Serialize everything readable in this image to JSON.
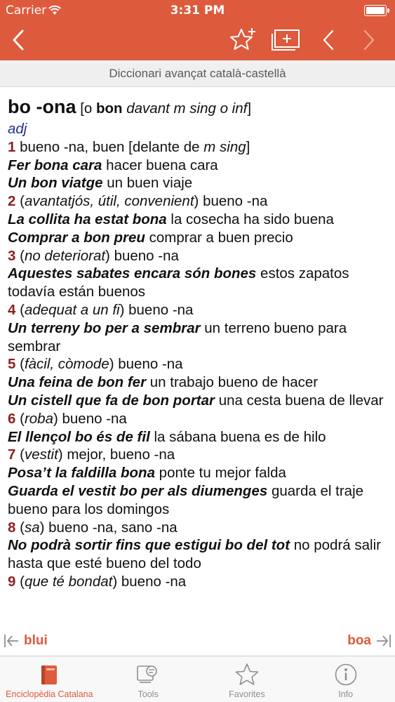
{
  "status_bar": {
    "carrier": "Carrier",
    "time": "3:31 PM"
  },
  "toolbar": {
    "icons": [
      "chevron-left-icon",
      "star-add-icon",
      "add-card-icon",
      "chevron-left-icon",
      "chevron-right-icon"
    ]
  },
  "subtitle": "Diccionari avançat català-castellà",
  "entry": {
    "headword": "bo -ona",
    "note_open": "[o ",
    "note_bold": "bon",
    "note_italic": " davant m sing o inf",
    "note_close": "]",
    "pos": "adj",
    "lines": {
      "n1": "1",
      "n1_text": " bueno -na, buen [delante de ",
      "n1_italic": "m sing",
      "n1_close": "]",
      "ex1": "Fer bona cara",
      "ex1_tr": " hacer buena cara",
      "ex2": "Un bon viatge",
      "ex2_tr": " un buen viaje",
      "n2": "2",
      "n2_open": " (",
      "n2_gloss": "avantatjós, útil, convenient",
      "n2_text": ") bueno -na",
      "ex3": "La collita ha estat bona",
      "ex3_tr": " la cosecha ha sido buena",
      "ex4": "Comprar a bon preu",
      "ex4_tr": " comprar a buen precio",
      "n3": "3",
      "n3_open": " (",
      "n3_gloss": "no deteriorat",
      "n3_text": ") bueno -na",
      "ex5": "Aquestes sabates encara són bones",
      "ex5_tr": " estos zapatos todavía están buenos",
      "n4": "4",
      "n4_open": " (",
      "n4_gloss": "adequat a un fi",
      "n4_text": ") bueno -na",
      "ex6": "Un terreny bo per a sembrar",
      "ex6_tr": " un terreno bueno para sembrar",
      "n5": "5",
      "n5_open": " (",
      "n5_gloss": "fàcil, còmode",
      "n5_text": ") bueno -na",
      "ex7": "Una feina de bon fer",
      "ex7_tr": " un trabajo bueno de hacer",
      "ex8": "Un cistell que fa de bon portar",
      "ex8_tr": " una cesta buena de llevar",
      "n6": "6",
      "n6_open": " (",
      "n6_gloss": "roba",
      "n6_text": ") bueno -na",
      "ex9": "El llençol bo és de fil",
      "ex9_tr": " la sábana buena es de hilo",
      "n7": "7",
      "n7_open": " (",
      "n7_gloss": "vestit",
      "n7_text": ") mejor, bueno -na",
      "ex10": "Posa’t la faldilla bona",
      "ex10_tr": " ponte tu mejor falda",
      "ex11": "Guarda el vestit bo per als diumenges",
      "ex11_tr": " guarda el traje bueno para los domingos",
      "n8": "8",
      "n8_open": " (",
      "n8_gloss": "sa",
      "n8_text": ") bueno -na, sano -na",
      "ex12": "No podrà sortir fins que estigui bo del tot",
      "ex12_tr": " no podrá salir hasta que esté bueno del todo",
      "n9": "9",
      "n9_open": " (",
      "n9_gloss": "que té bondat",
      "n9_text": ") bueno -na"
    }
  },
  "navigation": {
    "prev_entry": "blui",
    "next_entry": "boa"
  },
  "tabs": [
    {
      "label": "Enciclopèdia Catalana",
      "icon": "book-icon",
      "active": true
    },
    {
      "label": "Tools",
      "icon": "tools-icon",
      "active": false
    },
    {
      "label": "Favorites",
      "icon": "star-icon",
      "active": false
    },
    {
      "label": "Info",
      "icon": "info-icon",
      "active": false
    }
  ],
  "colors": {
    "accent": "#dd5a3c",
    "sense_number": "#8e1f1f",
    "pos": "#232f8e",
    "subtitle_bg": "#efefef"
  }
}
